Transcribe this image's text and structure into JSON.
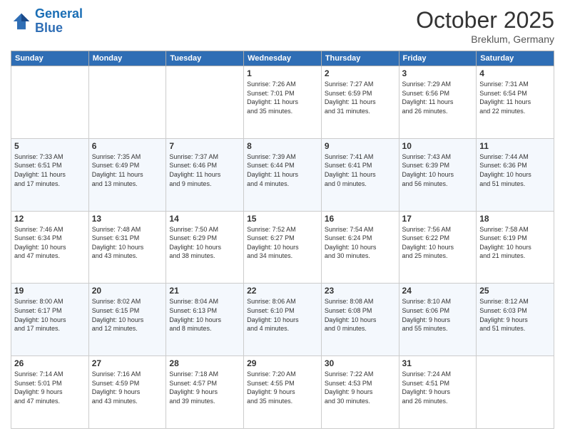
{
  "header": {
    "logo_line1": "General",
    "logo_line2": "Blue",
    "month_title": "October 2025",
    "location": "Breklum, Germany"
  },
  "weekdays": [
    "Sunday",
    "Monday",
    "Tuesday",
    "Wednesday",
    "Thursday",
    "Friday",
    "Saturday"
  ],
  "weeks": [
    [
      {
        "day": "",
        "info": ""
      },
      {
        "day": "",
        "info": ""
      },
      {
        "day": "",
        "info": ""
      },
      {
        "day": "1",
        "info": "Sunrise: 7:26 AM\nSunset: 7:01 PM\nDaylight: 11 hours\nand 35 minutes."
      },
      {
        "day": "2",
        "info": "Sunrise: 7:27 AM\nSunset: 6:59 PM\nDaylight: 11 hours\nand 31 minutes."
      },
      {
        "day": "3",
        "info": "Sunrise: 7:29 AM\nSunset: 6:56 PM\nDaylight: 11 hours\nand 26 minutes."
      },
      {
        "day": "4",
        "info": "Sunrise: 7:31 AM\nSunset: 6:54 PM\nDaylight: 11 hours\nand 22 minutes."
      }
    ],
    [
      {
        "day": "5",
        "info": "Sunrise: 7:33 AM\nSunset: 6:51 PM\nDaylight: 11 hours\nand 17 minutes."
      },
      {
        "day": "6",
        "info": "Sunrise: 7:35 AM\nSunset: 6:49 PM\nDaylight: 11 hours\nand 13 minutes."
      },
      {
        "day": "7",
        "info": "Sunrise: 7:37 AM\nSunset: 6:46 PM\nDaylight: 11 hours\nand 9 minutes."
      },
      {
        "day": "8",
        "info": "Sunrise: 7:39 AM\nSunset: 6:44 PM\nDaylight: 11 hours\nand 4 minutes."
      },
      {
        "day": "9",
        "info": "Sunrise: 7:41 AM\nSunset: 6:41 PM\nDaylight: 11 hours\nand 0 minutes."
      },
      {
        "day": "10",
        "info": "Sunrise: 7:43 AM\nSunset: 6:39 PM\nDaylight: 10 hours\nand 56 minutes."
      },
      {
        "day": "11",
        "info": "Sunrise: 7:44 AM\nSunset: 6:36 PM\nDaylight: 10 hours\nand 51 minutes."
      }
    ],
    [
      {
        "day": "12",
        "info": "Sunrise: 7:46 AM\nSunset: 6:34 PM\nDaylight: 10 hours\nand 47 minutes."
      },
      {
        "day": "13",
        "info": "Sunrise: 7:48 AM\nSunset: 6:31 PM\nDaylight: 10 hours\nand 43 minutes."
      },
      {
        "day": "14",
        "info": "Sunrise: 7:50 AM\nSunset: 6:29 PM\nDaylight: 10 hours\nand 38 minutes."
      },
      {
        "day": "15",
        "info": "Sunrise: 7:52 AM\nSunset: 6:27 PM\nDaylight: 10 hours\nand 34 minutes."
      },
      {
        "day": "16",
        "info": "Sunrise: 7:54 AM\nSunset: 6:24 PM\nDaylight: 10 hours\nand 30 minutes."
      },
      {
        "day": "17",
        "info": "Sunrise: 7:56 AM\nSunset: 6:22 PM\nDaylight: 10 hours\nand 25 minutes."
      },
      {
        "day": "18",
        "info": "Sunrise: 7:58 AM\nSunset: 6:19 PM\nDaylight: 10 hours\nand 21 minutes."
      }
    ],
    [
      {
        "day": "19",
        "info": "Sunrise: 8:00 AM\nSunset: 6:17 PM\nDaylight: 10 hours\nand 17 minutes."
      },
      {
        "day": "20",
        "info": "Sunrise: 8:02 AM\nSunset: 6:15 PM\nDaylight: 10 hours\nand 12 minutes."
      },
      {
        "day": "21",
        "info": "Sunrise: 8:04 AM\nSunset: 6:13 PM\nDaylight: 10 hours\nand 8 minutes."
      },
      {
        "day": "22",
        "info": "Sunrise: 8:06 AM\nSunset: 6:10 PM\nDaylight: 10 hours\nand 4 minutes."
      },
      {
        "day": "23",
        "info": "Sunrise: 8:08 AM\nSunset: 6:08 PM\nDaylight: 10 hours\nand 0 minutes."
      },
      {
        "day": "24",
        "info": "Sunrise: 8:10 AM\nSunset: 6:06 PM\nDaylight: 9 hours\nand 55 minutes."
      },
      {
        "day": "25",
        "info": "Sunrise: 8:12 AM\nSunset: 6:03 PM\nDaylight: 9 hours\nand 51 minutes."
      }
    ],
    [
      {
        "day": "26",
        "info": "Sunrise: 7:14 AM\nSunset: 5:01 PM\nDaylight: 9 hours\nand 47 minutes."
      },
      {
        "day": "27",
        "info": "Sunrise: 7:16 AM\nSunset: 4:59 PM\nDaylight: 9 hours\nand 43 minutes."
      },
      {
        "day": "28",
        "info": "Sunrise: 7:18 AM\nSunset: 4:57 PM\nDaylight: 9 hours\nand 39 minutes."
      },
      {
        "day": "29",
        "info": "Sunrise: 7:20 AM\nSunset: 4:55 PM\nDaylight: 9 hours\nand 35 minutes."
      },
      {
        "day": "30",
        "info": "Sunrise: 7:22 AM\nSunset: 4:53 PM\nDaylight: 9 hours\nand 30 minutes."
      },
      {
        "day": "31",
        "info": "Sunrise: 7:24 AM\nSunset: 4:51 PM\nDaylight: 9 hours\nand 26 minutes."
      },
      {
        "day": "",
        "info": ""
      }
    ]
  ]
}
